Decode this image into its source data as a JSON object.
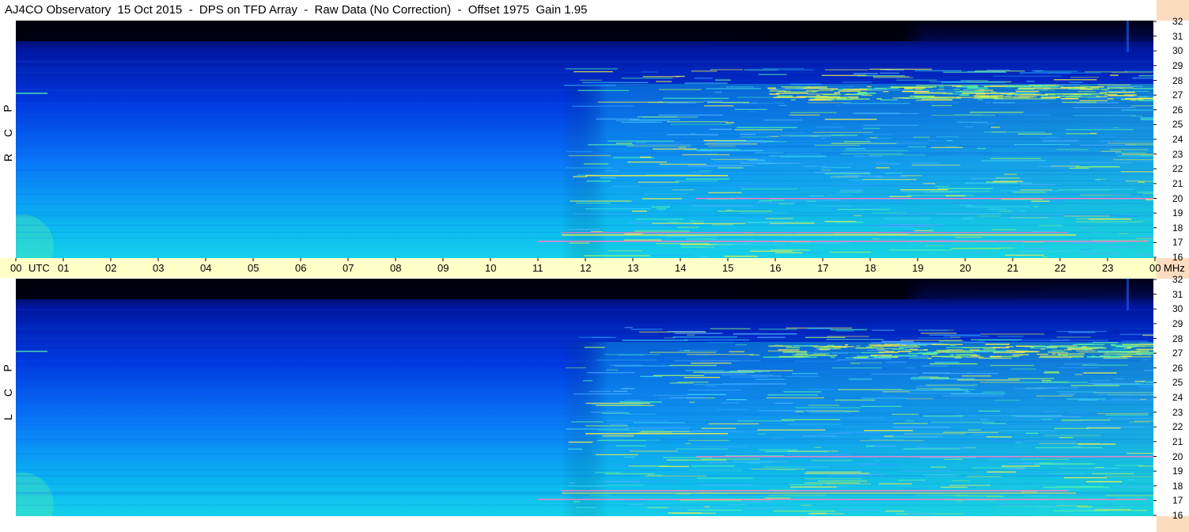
{
  "title": "AJ4CO Observatory  15 Oct 2015  -  DPS on TFD Array  -  Raw Data (No Correction)  -  Offset 1975  Gain 1.95",
  "panels": [
    {
      "label": "R C P",
      "letters": [
        "P",
        "C",
        "R"
      ]
    },
    {
      "label": "L C P",
      "letters": [
        "P",
        "C",
        "L"
      ]
    }
  ],
  "time_axis": {
    "ticks": [
      "00",
      "01",
      "02",
      "03",
      "04",
      "05",
      "06",
      "07",
      "08",
      "09",
      "10",
      "11",
      "12",
      "13",
      "14",
      "15",
      "16",
      "17",
      "18",
      "19",
      "20",
      "21",
      "22",
      "23",
      "00"
    ],
    "unit": "UTC",
    "freq_unit": "MHz"
  },
  "chart_data": {
    "type": "heatmap",
    "title": "AJ4CO Observatory  15 Oct 2015  -  DPS on TFD Array  -  Raw Data (No Correction)  -  Offset 1975  Gain 1.95",
    "x": [
      "00",
      "01",
      "02",
      "03",
      "04",
      "05",
      "06",
      "07",
      "08",
      "09",
      "10",
      "11",
      "12",
      "13",
      "14",
      "15",
      "16",
      "17",
      "18",
      "19",
      "20",
      "21",
      "22",
      "23",
      "00"
    ],
    "xlabel": "UTC",
    "ylabel": "MHz",
    "ylim": [
      16,
      32
    ],
    "yticks": [
      16,
      17,
      18,
      19,
      20,
      21,
      22,
      23,
      24,
      25,
      26,
      27,
      28,
      29,
      30,
      31,
      32
    ],
    "panels": [
      "R C P",
      "L C P"
    ],
    "colormap": [
      "#000018",
      "#000a7a",
      "#0032d6",
      "#0a78ff",
      "#14c8f0",
      "#50f0a0",
      "#f0f050",
      "#ff80c0"
    ],
    "colors": {
      "background_band": "#ffffc8",
      "right_edge": "#fcdcbe"
    }
  }
}
